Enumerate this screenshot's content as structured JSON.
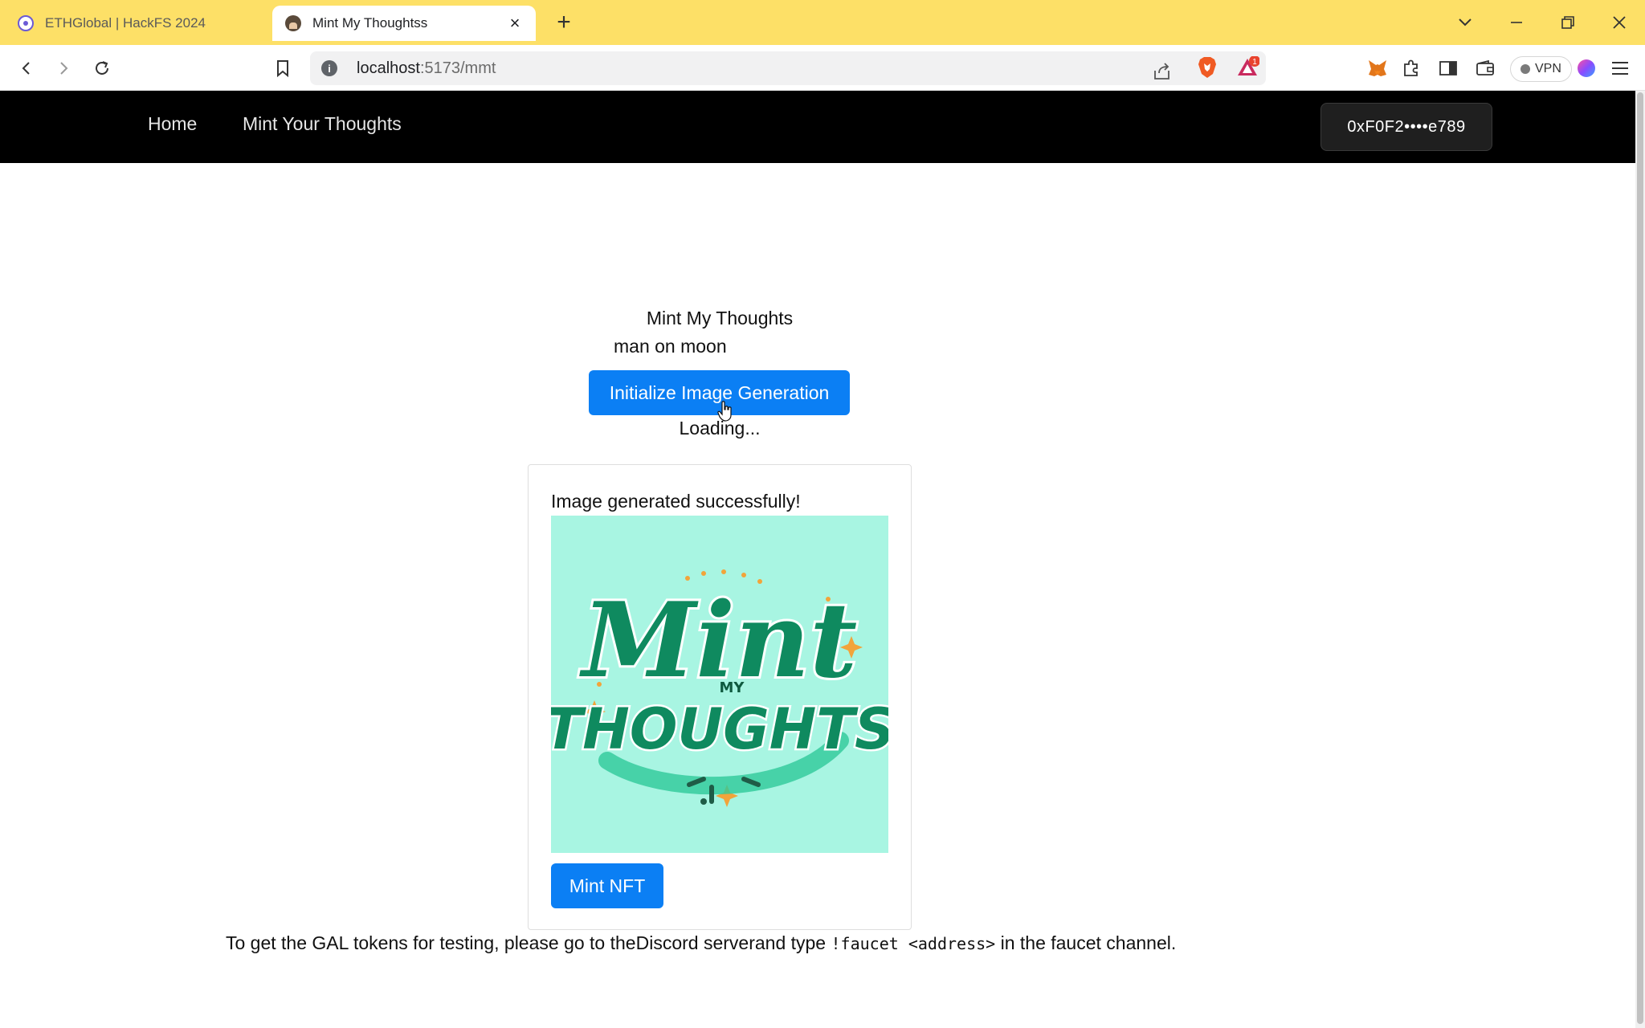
{
  "browser": {
    "tabs": [
      {
        "title": "ETHGlobal | HackFS 2024",
        "active": false,
        "favicon": "ethglobal-icon"
      },
      {
        "title": "Mint My Thoughtss",
        "active": true,
        "favicon": "mmt-avatar-icon"
      }
    ],
    "new_tab_label": "+",
    "close_glyph": "×",
    "url_host": "localhost",
    "url_path": ":5173/mmt",
    "vpn_label": "VPN",
    "notification_count": "1"
  },
  "navbar": {
    "links": [
      "Home",
      "Mint Your Thoughts"
    ],
    "wallet_address": "0xF0F2••••e789"
  },
  "main": {
    "heading": "Mint My Thoughts",
    "prompt_text": "man on moon",
    "generate_button": "Initialize Image Generation",
    "loading_text": "Loading...",
    "result": {
      "status_text": "Image generated successfully!",
      "image_art_lettering": [
        "Mint",
        "MY",
        "THOUGHTS"
      ],
      "mint_button": "Mint NFT"
    }
  },
  "footer": {
    "text_before": "To get the GAL tokens for testing, please go to the",
    "link_text": "Discord server",
    "text_middle": "and type ",
    "command": "!faucet <address>",
    "text_after": " in the faucet channel."
  },
  "colors": {
    "tabstrip_bg": "#fde067",
    "navbar_bg": "#000000",
    "primary_button": "#0b7ff4",
    "art_bg": "#a8f5e2",
    "art_green": "#0f8a5f"
  }
}
